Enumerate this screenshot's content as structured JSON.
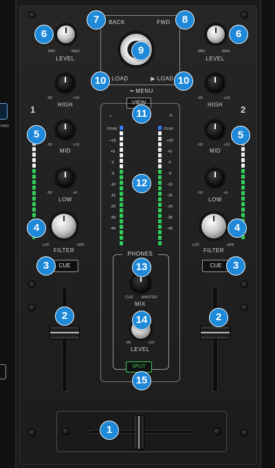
{
  "deck_left": {
    "number": "1",
    "level": {
      "label": "LEVEL",
      "min": "MIN",
      "max": "MAX"
    },
    "high": {
      "label": "HIGH",
      "min": "-90",
      "max": "+10"
    },
    "mid": {
      "label": "MID",
      "min": "-90",
      "max": "+10"
    },
    "low": {
      "label": "LOW",
      "min": "-90",
      "max": "+6"
    },
    "filter": {
      "label": "FILTER",
      "lpf": "LPF",
      "hpf": "HPF"
    },
    "cue_label": "CUE"
  },
  "deck_right": {
    "number": "2",
    "level": {
      "label": "LEVEL",
      "min": "MIN",
      "max": "MAX"
    },
    "high": {
      "label": "HIGH",
      "min": "-90",
      "max": "+10"
    },
    "mid": {
      "label": "MID",
      "min": "-90",
      "max": "+10"
    },
    "low": {
      "label": "LOW",
      "min": "-90",
      "max": "+6"
    },
    "filter": {
      "label": "FILTER",
      "lpf": "LPF",
      "hpf": "HPF"
    },
    "cue_label": "CUE"
  },
  "browser": {
    "back_label": "BACK",
    "fwd_label": "FWD",
    "load_left_label": "LOAD",
    "load_right_label": "LOAD",
    "menu_label": "MENU",
    "view_label": "VIEW"
  },
  "master_meter": {
    "title": "MA",
    "left": "L",
    "right": "R",
    "peak_left": "PEAK",
    "peak_right": "PEAK",
    "scale_left": [
      "+10",
      "+5",
      "0",
      "-5",
      "-10",
      "-15",
      "-20",
      "-30",
      "-40"
    ],
    "scale_right": [
      "+10",
      "+5",
      "0",
      "-5",
      "-10",
      "-15",
      "-20",
      "-30",
      "-40"
    ]
  },
  "phones": {
    "title": "PHONES",
    "mix_label": "MIX",
    "cue": "CUE",
    "master": "MASTER",
    "level_label": "LEVEL",
    "min": "-90",
    "max": "+10",
    "split_label": "SPLIT"
  },
  "side_text": "PHO",
  "callouts": [
    "1",
    "2",
    "2",
    "3",
    "3",
    "4",
    "4",
    "5",
    "5",
    "6",
    "6",
    "7",
    "8",
    "9",
    "10",
    "10",
    "11",
    "12",
    "13",
    "14",
    "15"
  ],
  "colors": {
    "callout": "#1e88d9",
    "meter_green": "#2fd05a",
    "meter_white": "#f2f2f2",
    "meter_blue": "#2f7fff"
  }
}
